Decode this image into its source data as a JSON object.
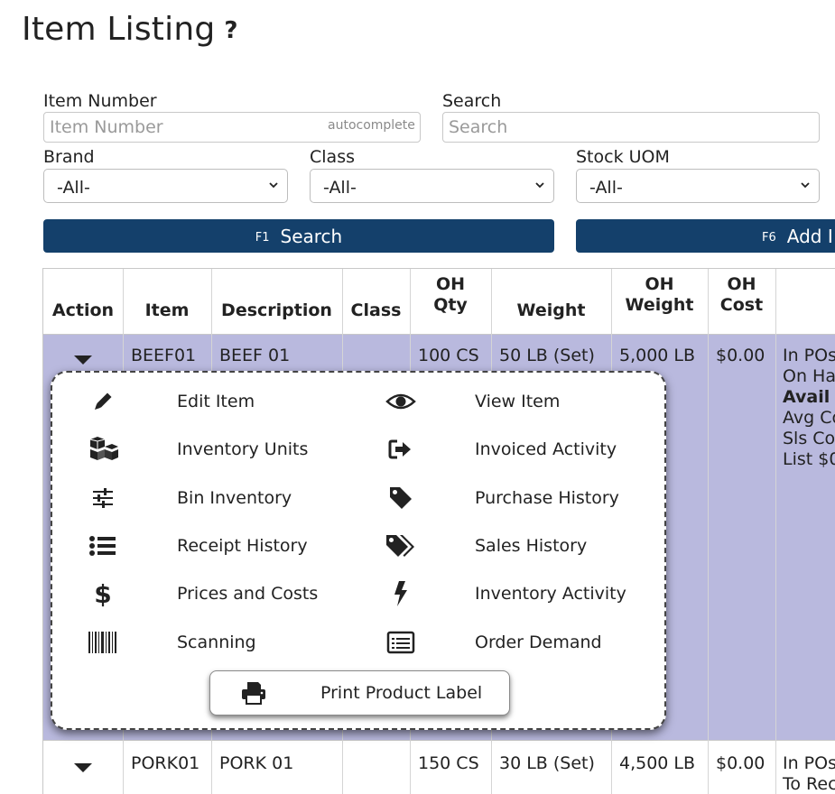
{
  "page": {
    "title": "Item Listing",
    "help": "?"
  },
  "filters": {
    "item_number_label": "Item Number",
    "item_number_placeholder": "Item Number",
    "autocomplete_hint": "autocomplete",
    "search_label": "Search",
    "search_placeholder": "Search",
    "brand_label": "Brand",
    "brand_value": "-All-",
    "class_label": "Class",
    "class_value": "-All-",
    "uom_label": "Stock UOM",
    "uom_value": "-All-"
  },
  "buttons": {
    "search": {
      "key": "F1",
      "label": "Search"
    },
    "add": {
      "key": "F6",
      "label": "Add I"
    }
  },
  "table": {
    "headers": {
      "action": "Action",
      "item": "Item",
      "description": "Description",
      "class": "Class",
      "oh_qty_1": "OH",
      "oh_qty_2": "Qty",
      "weight": "Weight",
      "oh_weight_1": "OH",
      "oh_weight_2": "Weight",
      "oh_cost_1": "OH",
      "oh_cost_2": "Cost"
    },
    "rows": [
      {
        "item": "BEEF01",
        "description": "BEEF 01",
        "class": "",
        "oh_qty": "100 CS",
        "weight": "50 LB (Set)",
        "oh_weight": "5,000 LB",
        "oh_cost": "$0.00",
        "notes": [
          "In POs",
          "On Ha",
          "Avail",
          "Avg Co",
          "Sls Co",
          "List $0"
        ]
      },
      {
        "item": "PORK01",
        "description": "PORK 01",
        "class": "",
        "oh_qty": "150 CS",
        "weight": "30 LB (Set)",
        "oh_weight": "4,500 LB",
        "oh_cost": "$0.00",
        "notes": [
          "In POs",
          "To Rec"
        ]
      }
    ]
  },
  "action_menu": {
    "items": [
      {
        "label": "Edit Item",
        "icon": "pencil-icon"
      },
      {
        "label": "View Item",
        "icon": "eye-icon"
      },
      {
        "label": "Inventory Units",
        "icon": "cubes-icon"
      },
      {
        "label": "Invoiced Activity",
        "icon": "sign-out-icon"
      },
      {
        "label": "Bin Inventory",
        "icon": "sliders-icon"
      },
      {
        "label": "Purchase History",
        "icon": "tag-icon"
      },
      {
        "label": "Receipt History",
        "icon": "list-icon"
      },
      {
        "label": "Sales History",
        "icon": "tags-icon"
      },
      {
        "label": "Prices and Costs",
        "icon": "dollar-icon"
      },
      {
        "label": "Inventory Activity",
        "icon": "bolt-icon"
      },
      {
        "label": "Scanning",
        "icon": "barcode-icon"
      },
      {
        "label": "Order Demand",
        "icon": "list-alt-icon"
      }
    ],
    "print_label": "Print Product Label",
    "print_icon": "print-icon"
  },
  "colors": {
    "button_bg": "#14406b",
    "selected_row": "#b9b9de"
  }
}
